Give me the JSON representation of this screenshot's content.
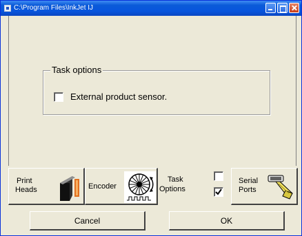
{
  "window": {
    "title": "C:\\Program Files\\InkJet   IJ"
  },
  "task_options": {
    "group_title": "Task options",
    "external_sensor": {
      "label": "External product sensor.",
      "checked": false
    }
  },
  "tabs": [
    {
      "label_line1": "Print",
      "label_line2": "Heads",
      "icon": "print-head-icon"
    },
    {
      "label": "Encoder",
      "icon": "encoder-wheel-icon"
    },
    {
      "label_line1": "Task",
      "label_line2": "Options",
      "icon": "checkbox-pair-icon",
      "selected": true
    },
    {
      "label_line1": "Serial",
      "label_line2": "Ports",
      "icon": "serial-cable-icon"
    }
  ],
  "buttons": {
    "cancel": "Cancel",
    "ok": "OK"
  },
  "colors": {
    "titlebar": "#0a5ad8",
    "face": "#ece9d8",
    "print_head_accent": "#e07020",
    "serial_cable": "#f0e060"
  }
}
